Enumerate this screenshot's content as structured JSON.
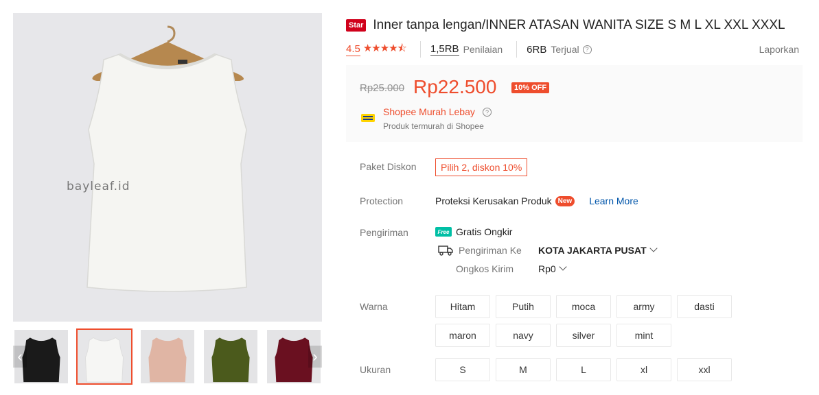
{
  "gallery": {
    "watermark": "bayleaf.id",
    "thumbnail_colors": [
      "#1a1a1a",
      "#f4f4f2",
      "#e0b5a4",
      "#4b5a1c",
      "#6a1020"
    ],
    "active_thumbnail": 1,
    "prev_arrow": "‹",
    "next_arrow": "›"
  },
  "header": {
    "badge": "Star",
    "title": "Inner tanpa lengan/INNER ATASAN WANITA SIZE S M L XL XXL XXXL",
    "rating": "4.5",
    "stars": "★★★★⯪",
    "ratings_count": "1,5RB",
    "ratings_label": "Penilaian",
    "sold_count": "6RB",
    "sold_label": "Terjual",
    "help_icon": "?",
    "report_label": "Laporkan"
  },
  "price": {
    "original": "Rp25.000",
    "current": "Rp22.500",
    "discount": "10% OFF",
    "promo_title": "Shopee Murah Lebay",
    "promo_subtitle": "Produk termurah di Shopee",
    "promo_help": "?"
  },
  "details": {
    "paket_label": "Paket Diskon",
    "paket_value": "Pilih 2, diskon 10%",
    "protection_label": "Protection",
    "protection_value": "Proteksi Kerusakan Produk",
    "protection_badge": "New",
    "learn_more": "Learn More",
    "shipping_label": "Pengiriman",
    "free_badge": "Free",
    "free_shipping": "Gratis Ongkir",
    "ship_to_label": "Pengiriman Ke",
    "ship_to_value": "KOTA JAKARTA PUSAT",
    "cost_label": "Ongkos Kirim",
    "cost_value": "Rp0"
  },
  "variants": {
    "color_label": "Warna",
    "colors": [
      "Hitam",
      "Putih",
      "moca",
      "army",
      "dasti",
      "maron",
      "navy",
      "silver",
      "mint"
    ],
    "size_label": "Ukuran",
    "sizes": [
      "S",
      "M",
      "L",
      "xl",
      "xxl"
    ]
  },
  "theme": {
    "accent": "#ee4d2d"
  }
}
